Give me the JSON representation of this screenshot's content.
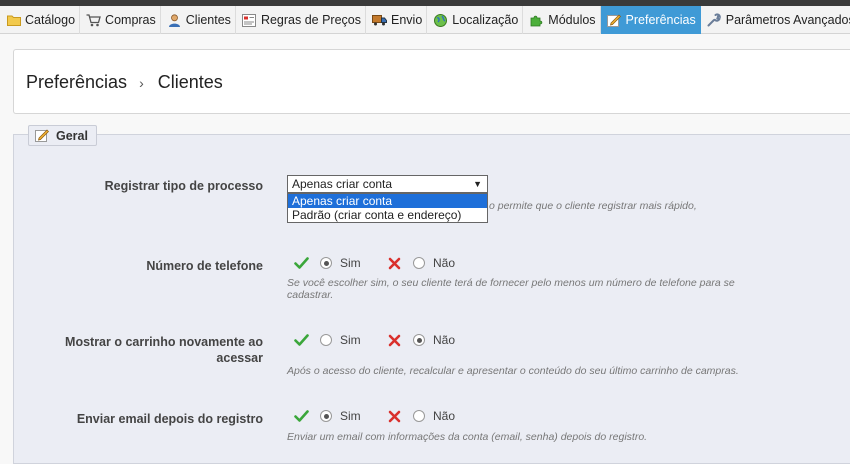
{
  "tabs": [
    {
      "label": "Catálogo",
      "icon": "folder-icon"
    },
    {
      "label": "Compras",
      "icon": "cart-icon"
    },
    {
      "label": "Clientes",
      "icon": "user-icon"
    },
    {
      "label": "Regras de Preços",
      "icon": "price-rules-icon"
    },
    {
      "label": "Envio",
      "icon": "truck-icon"
    },
    {
      "label": "Localização",
      "icon": "globe-icon"
    },
    {
      "label": "Módulos",
      "icon": "puzzle-icon"
    },
    {
      "label": "Preferências",
      "icon": "preferences-icon",
      "active": true
    },
    {
      "label": "Parâmetros Avançados",
      "icon": "wrench-icon"
    }
  ],
  "breadcrumb": {
    "parent": "Preferências",
    "separator": "›",
    "current": "Clientes"
  },
  "fieldset": {
    "legend": "Geral"
  },
  "fields": {
    "register_process": {
      "label": "Registrar tipo de processo",
      "selected": "Apenas criar conta",
      "options": [
        "Apenas criar conta",
        "Padrão (criar conta e endereço)"
      ],
      "hint_partial": "o permite que o cliente registrar mais rápido,"
    },
    "phone": {
      "label": "Número de telefone",
      "yes": "Sim",
      "no": "Não",
      "value": "yes",
      "hint_line1": "Se você escolher sim, o seu cliente terá de fornecer pelo menos um número de telefone para se",
      "hint_line2": "cadastrar."
    },
    "cart": {
      "label_line1": "Mostrar o carrinho novamente ao",
      "label_line2": "acessar",
      "yes": "Sim",
      "no": "Não",
      "value": "no",
      "hint": "Após o acesso do cliente, recalcular e apresentar o conteúdo do seu último carrinho de campras."
    },
    "email": {
      "label": "Enviar email depois do registro",
      "yes": "Sim",
      "no": "Não",
      "value": "yes",
      "hint": "Enviar um email com informações da conta (email, senha) depois do registro."
    }
  },
  "colors": {
    "active_tab": "#3f9ad6",
    "check": "#3aa63a",
    "cross": "#d9302c",
    "selected_option": "#1e6fd9"
  }
}
